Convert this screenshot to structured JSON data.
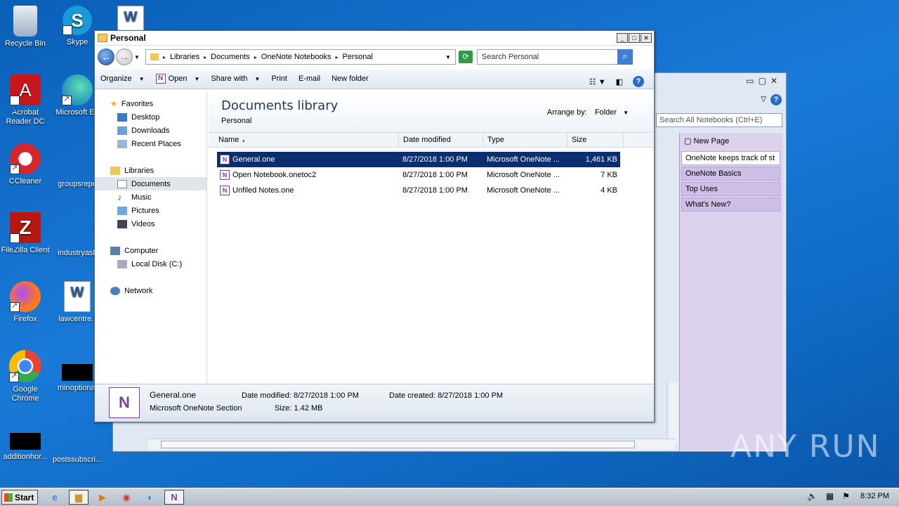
{
  "desktop": {
    "icons": [
      {
        "label": "Recycle Bin"
      },
      {
        "label": "Skype"
      },
      {
        "label": "Acrobat Reader DC"
      },
      {
        "label": "Microsoft Ed"
      },
      {
        "label": "CCleaner"
      },
      {
        "label": "groupsrepo"
      },
      {
        "label": "FileZilla Client"
      },
      {
        "label": "industryask"
      },
      {
        "label": "Firefox"
      },
      {
        "label": "lawcentre.r"
      },
      {
        "label": "Google Chrome"
      },
      {
        "label": "minoptional"
      },
      {
        "label": "additionhor..."
      },
      {
        "label": "postssubscri..."
      }
    ]
  },
  "onenote": {
    "search_placeholder": "Search All Notebooks (Ctrl+E)",
    "new_page": "New Page",
    "pages": [
      "OneNote keeps track of st",
      "OneNote Basics",
      "Top Uses",
      "What's New?"
    ]
  },
  "explorer": {
    "title": "Personal",
    "breadcrumb": [
      "Libraries",
      "Documents",
      "OneNote Notebooks",
      "Personal"
    ],
    "search_placeholder": "Search Personal",
    "toolbar": {
      "organize": "Organize",
      "open": "Open",
      "share_with": "Share with",
      "print": "Print",
      "email": "E-mail",
      "new_folder": "New folder"
    },
    "nav": {
      "favorites": "Favorites",
      "desktop": "Desktop",
      "downloads": "Downloads",
      "recent": "Recent Places",
      "libraries": "Libraries",
      "documents": "Documents",
      "music": "Music",
      "pictures": "Pictures",
      "videos": "Videos",
      "computer": "Computer",
      "local_disk": "Local Disk (C:)",
      "network": "Network"
    },
    "library_title": "Documents library",
    "library_sub": "Personal",
    "arrange_label": "Arrange by:",
    "arrange_value": "Folder",
    "columns": {
      "name": "Name",
      "date": "Date modified",
      "type": "Type",
      "size": "Size"
    },
    "files": [
      {
        "name": "General.one",
        "date": "8/27/2018 1:00 PM",
        "type": "Microsoft OneNote ...",
        "size": "1,461 KB"
      },
      {
        "name": "Open Notebook.onetoc2",
        "date": "8/27/2018 1:00 PM",
        "type": "Microsoft OneNote ...",
        "size": "7 KB"
      },
      {
        "name": "Unfiled Notes.one",
        "date": "8/27/2018 1:00 PM",
        "type": "Microsoft OneNote ...",
        "size": "4 KB"
      }
    ],
    "details": {
      "name": "General.one",
      "type": "Microsoft OneNote Section",
      "modified_label": "Date modified:",
      "modified": "8/27/2018 1:00 PM",
      "created_label": "Date created:",
      "created": "8/27/2018 1:00 PM",
      "size_label": "Size:",
      "size": "1.42 MB"
    }
  },
  "taskbar": {
    "start": "Start",
    "clock": "8:32 PM"
  },
  "watermark": "ANY RUN"
}
